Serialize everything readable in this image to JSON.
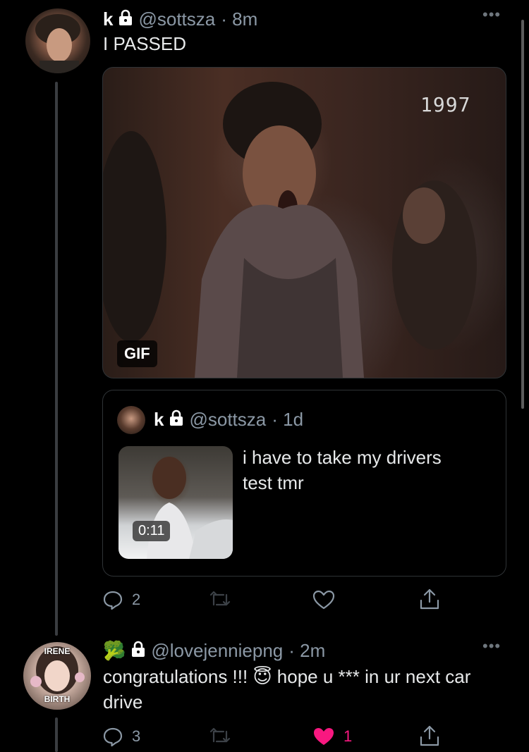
{
  "tweet1": {
    "name": "k",
    "handle": "@sottsza",
    "time": "· 8m",
    "text": "I PASSED",
    "media": {
      "badge": "GIF",
      "overlay_text": "1997"
    },
    "quote": {
      "name": "k",
      "handle": "@sottsza",
      "time": "· 1d",
      "text": "i have to take my drivers test tmr",
      "video_duration": "0:11"
    },
    "actions": {
      "replies": "2",
      "retweets": "",
      "likes": ""
    }
  },
  "tweet2": {
    "name_emoji": "🥦",
    "handle": "@lovejenniepng",
    "time": "· 2m",
    "text_before_emoji": "congratulations !!! ",
    "emoji": "😇",
    "text_after_emoji": " hope u *** in ur next car drive",
    "avatar_top_text": "IRENE",
    "avatar_bottom_text": "BIRTH",
    "actions": {
      "replies": "3",
      "retweets": "",
      "likes": "1"
    }
  },
  "icons": [
    "lock-icon",
    "more-icon",
    "reply-icon",
    "retweet-icon",
    "like-icon",
    "share-icon"
  ],
  "colors": {
    "background": "#000000",
    "secondary_text": "#8b98a5",
    "like_active": "#f91880"
  }
}
